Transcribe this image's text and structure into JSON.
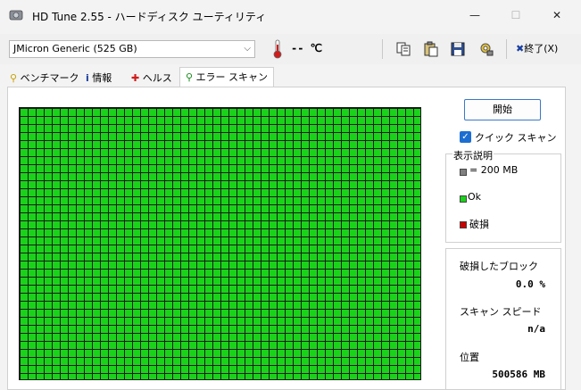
{
  "window": {
    "title": "HD Tune 2.55 - ハードディスク ユーティリティ",
    "minimize": "—",
    "maximize": "☐",
    "close": "✕"
  },
  "toolbar": {
    "drive": "JMicron Generic (525 GB)",
    "temperature": "-- ℃",
    "exit_label": "終了(X)",
    "icons": [
      "copy-icon",
      "paste-icon",
      "save-icon",
      "options-icon",
      "exit-icon"
    ]
  },
  "tabs": [
    {
      "label": "ベンチマーク",
      "icon": "benchmark-icon"
    },
    {
      "label": "情報",
      "icon": "info-icon"
    },
    {
      "label": "ヘルス",
      "icon": "health-icon"
    },
    {
      "label": "エラー スキャン",
      "icon": "magnifier-icon",
      "active": true
    }
  ],
  "scan": {
    "start_label": "開始",
    "quick_scan_label": "クイック スキャン",
    "quick_scan_checked": true,
    "grid_block_state": "ok"
  },
  "legend": {
    "title": "表示説明",
    "items": [
      {
        "label": "= 200 MB",
        "color": "#808080"
      },
      {
        "label": "Ok",
        "color": "#1bd21b"
      },
      {
        "label": "破損",
        "color": "#cc0000"
      }
    ]
  },
  "stats": {
    "damaged_label": "破損したブロック",
    "damaged_value": "0.0 %",
    "speed_label": "スキャン スピード",
    "speed_value": "n/a",
    "position_label": "位置",
    "position_value": "500586 MB"
  }
}
